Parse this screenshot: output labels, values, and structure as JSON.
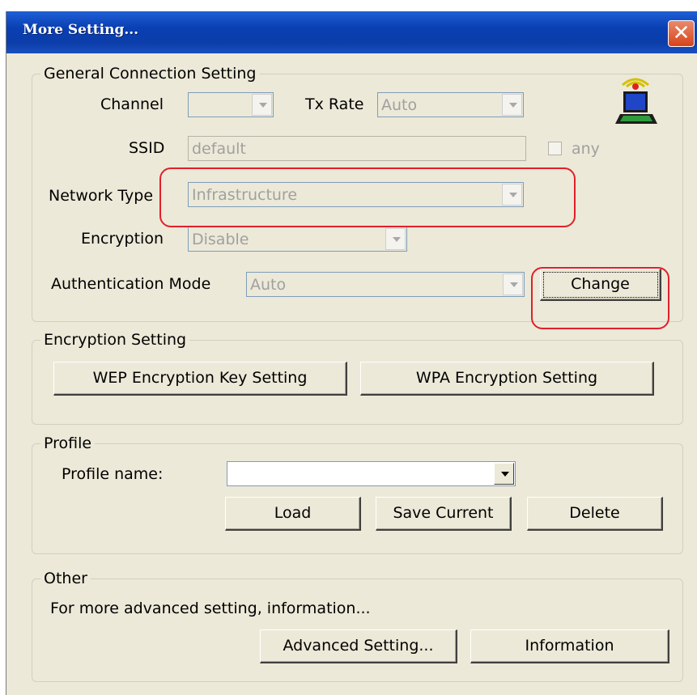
{
  "window": {
    "title": "More Setting...",
    "close_label": "✕"
  },
  "general": {
    "legend": "General Connection Setting",
    "channel_label": "Channel",
    "channel_value": "",
    "txrate_label": "Tx Rate",
    "txrate_value": "Auto",
    "ssid_label": "SSID",
    "ssid_value": "default",
    "any_label": "any",
    "any_checked": false,
    "network_type_label": "Network Type",
    "network_type_value": "Infrastructure",
    "encryption_label": "Encryption",
    "encryption_value": "Disable",
    "auth_label": "Authentication Mode",
    "auth_value": "Auto",
    "change_label": "Change"
  },
  "encryption_setting": {
    "legend": "Encryption Setting",
    "wep_label": "WEP Encryption Key Setting",
    "wpa_label": "WPA Encryption Setting"
  },
  "profile": {
    "legend": "Profile",
    "name_label": "Profile name:",
    "name_value": "",
    "load_label": "Load",
    "save_label": "Save Current",
    "delete_label": "Delete"
  },
  "other": {
    "legend": "Other",
    "description": "For more advanced setting, information...",
    "advanced_label": "Advanced Setting...",
    "information_label": "Information"
  },
  "colors": {
    "title_bar": "#0b3ea9",
    "dialog_bg": "#ece9d8",
    "highlight_outline": "#e0202a",
    "disabled_text": "#a0a0a0"
  }
}
